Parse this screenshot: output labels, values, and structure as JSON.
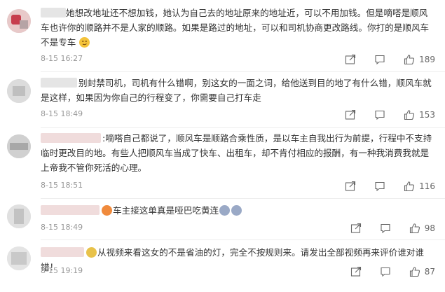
{
  "comments": [
    {
      "text": "她想改地址还不想加钱，她认为自己去的地址原来的地址近，可以不用加钱。但是嘀嗒是顺风车也许你的顺路并不是人家的顺路。如果是路过的地址，可以和司机协商更改路线。你打的是顺风车不是专车",
      "emoji": "smirk-emoji",
      "time": "8-15 16:27",
      "likes": "189"
    },
    {
      "text": "别封禁司机，司机有什么错啊，别这女的一面之词，给他送到目的地了有什么错，顺风车就是这样，如果因为你自己的行程变了，你需要自己打车走",
      "time": "8-15 18:49",
      "likes": "153"
    },
    {
      "text": ":嘀嗒自己都说了，顺风车是顺路合乘性质，是以车主自我出行为前提，行程中不支持临时更改目的地。有些人把顺风车当成了快车、出租车，却不肯付相应的报酬，有一种我消费我就是上帝我不管你死活的心理。",
      "time": "8-15 18:51",
      "likes": "116"
    },
    {
      "text": "车主接这单真是哑巴吃黄连",
      "time": "8-15 18:49",
      "likes": "98"
    },
    {
      "text": "从视频来看这女的不是省油的灯，完全不按规则来。请发出全部视频再来评价谁对谁错！",
      "time": "8-15 19:19",
      "likes": "87"
    }
  ],
  "colors": {
    "text": "#333333",
    "meta": "#999999",
    "divider": "#eeeeee"
  },
  "icons": [
    "share-icon",
    "comment-icon",
    "like-icon"
  ]
}
